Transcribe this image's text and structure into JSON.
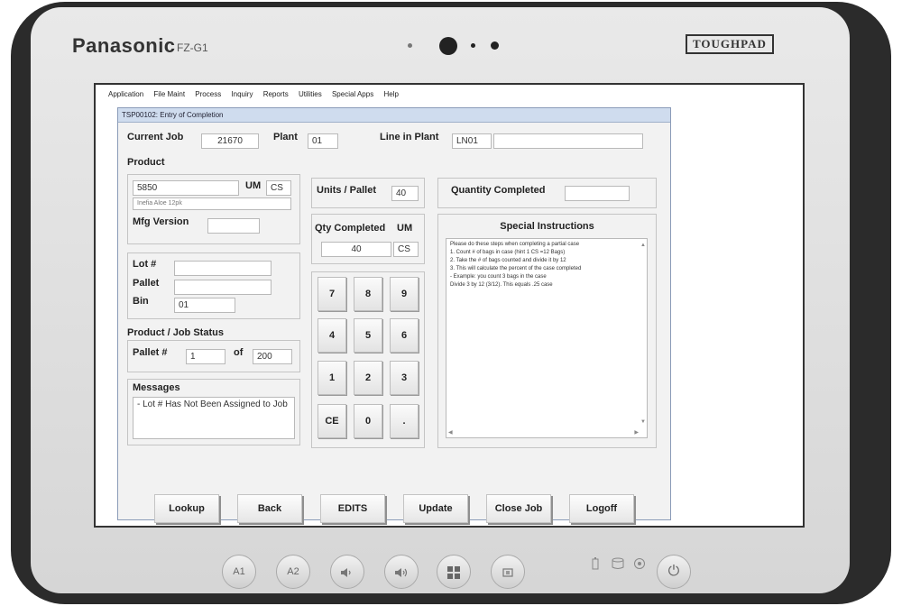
{
  "device": {
    "brand": "Panasonic",
    "model": "FZ-G1",
    "logo": "TOUGHPAD",
    "hw_buttons": [
      "A1",
      "A2",
      "volume-down-icon",
      "volume-up-icon",
      "windows-icon",
      "rotate-icon"
    ],
    "power_symbol": "⏻"
  },
  "menubar": {
    "items": [
      "Application",
      "File Maint",
      "Process",
      "Inquiry",
      "Reports",
      "Utilities",
      "Special Apps",
      "Help"
    ]
  },
  "window": {
    "title": "TSP00102: Entry of Completion"
  },
  "form": {
    "current_job_label": "Current Job",
    "current_job": "21670",
    "plant_label": "Plant",
    "plant": "01",
    "line_label": "Line in Plant",
    "line": "LN01",
    "line_desc": "",
    "product_label": "Product",
    "product_code": "5850",
    "um_label": "UM",
    "um": "CS",
    "product_desc": "Inefia Aloe 12pk",
    "mfg_version_label": "Mfg Version",
    "mfg_version": "",
    "lot_label": "Lot #",
    "lot": "",
    "pallet_label": "Pallet",
    "pallet": "",
    "bin_label": "Bin",
    "bin": "01",
    "status_label": "Product / Job Status",
    "pallet_num_label": "Pallet #",
    "pallet_num": "1",
    "of_label": "of",
    "pallet_total": "200",
    "messages_label": "Messages",
    "messages": "- Lot # Has Not Been Assigned to Job",
    "units_pallet_label": "Units / Pallet",
    "units_pallet": "40",
    "qty_completed_label": "Qty Completed",
    "qty_um_label": "UM",
    "qty_completed": "40",
    "qty_um": "CS",
    "quantity_completed_label": "Quantity Completed",
    "quantity_completed": "",
    "special_label": "Special Instructions",
    "special_lines": [
      "Please do these steps when completing a partial case",
      "1. Count # of bags in case (hint 1 CS =12 Bags)",
      "2. Take the # of bags counted and divide it by 12",
      "3. This will calculate the percent of the case completed",
      "- Example: you count 3 bags in the case",
      "Divide 3 by 12 (3/12). This equals .25 case"
    ]
  },
  "keypad": {
    "keys": [
      "7",
      "8",
      "9",
      "4",
      "5",
      "6",
      "1",
      "2",
      "3",
      "CE",
      "0",
      "."
    ]
  },
  "buttons": [
    "Lookup",
    "Back",
    "EDITS",
    "Update",
    "Close Job",
    "Logoff"
  ]
}
